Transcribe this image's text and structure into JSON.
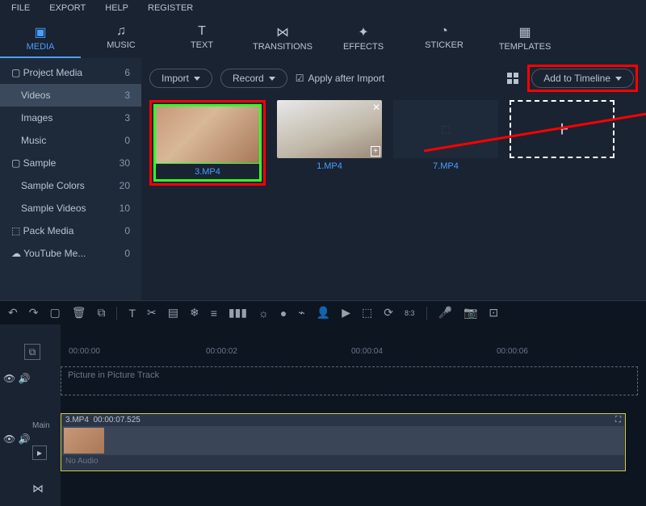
{
  "menu": {
    "file": "FILE",
    "export": "EXPORT",
    "help": "HELP",
    "register": "REGISTER"
  },
  "tabs": [
    {
      "label": "MEDIA",
      "icon": "image-stack-icon"
    },
    {
      "label": "MUSIC",
      "icon": "music-note-icon"
    },
    {
      "label": "TEXT",
      "icon": "text-icon"
    },
    {
      "label": "TRANSITIONS",
      "icon": "bowtie-icon"
    },
    {
      "label": "EFFECTS",
      "icon": "sparkle-icon"
    },
    {
      "label": "STICKER",
      "icon": "clock-icon"
    },
    {
      "label": "TEMPLATES",
      "icon": "grid-icon"
    }
  ],
  "sidebar": {
    "items": [
      {
        "label": "Project Media",
        "count": "6",
        "icon": "folder"
      },
      {
        "label": "Videos",
        "count": "3"
      },
      {
        "label": "Images",
        "count": "3"
      },
      {
        "label": "Music",
        "count": "0"
      },
      {
        "label": "Sample",
        "count": "30",
        "icon": "folder"
      },
      {
        "label": "Sample Colors",
        "count": "20"
      },
      {
        "label": "Sample Videos",
        "count": "10"
      },
      {
        "label": "Pack Media",
        "count": "0",
        "icon": "box"
      },
      {
        "label": "YouTube Me...",
        "count": "0",
        "icon": "cloud"
      }
    ]
  },
  "toolbar": {
    "import": "Import",
    "record": "Record",
    "apply": "Apply after Import",
    "addtl": "Add to Timeline"
  },
  "thumbs": [
    {
      "label": "3.MP4"
    },
    {
      "label": "1.MP4"
    },
    {
      "label": "7.MP4"
    }
  ],
  "addcard": "+",
  "ruler": [
    "00:00:00",
    "00:00:02",
    "00:00:04",
    "00:00:06"
  ],
  "pip": "Picture in Picture Track",
  "clip": {
    "name": "3.MP4",
    "dur": "00:00:07.525",
    "noaudio": "No Audio"
  },
  "tracks": {
    "main": "Main"
  }
}
